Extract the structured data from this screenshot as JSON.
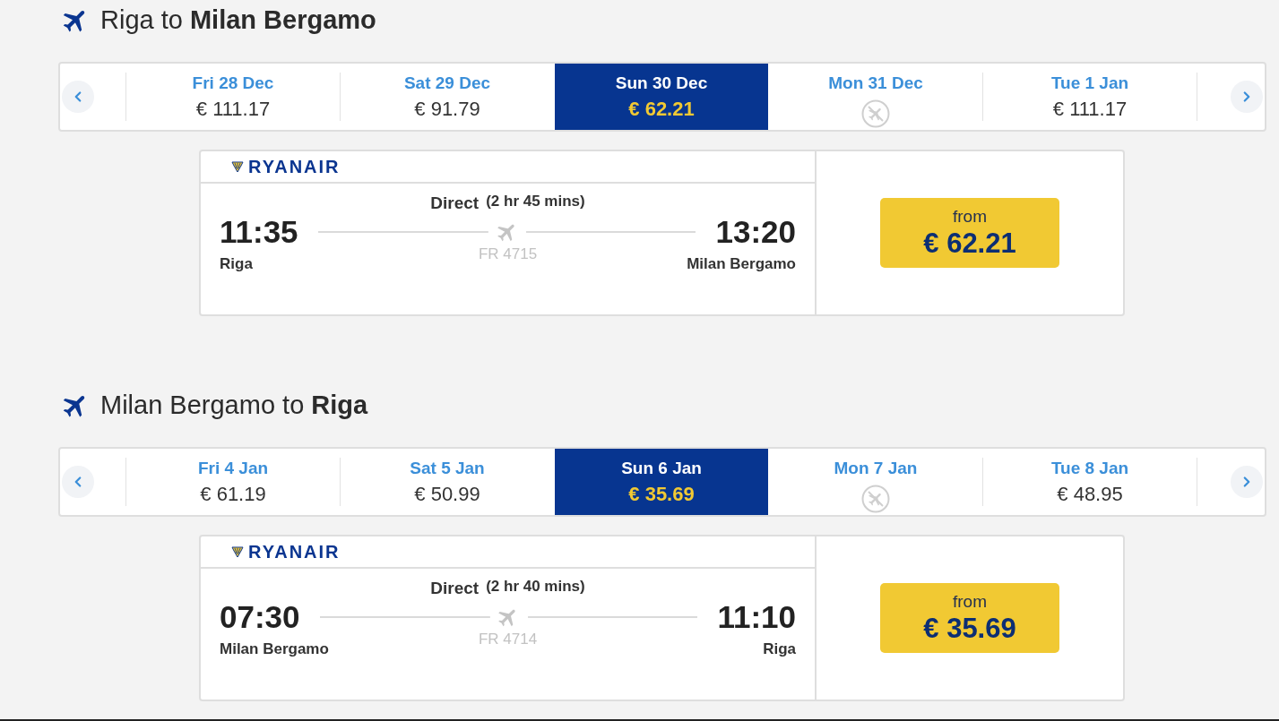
{
  "journeys": [
    {
      "title": "Riga to **Milan Bergamo**",
      "dates": [
        {
          "kind": "fare",
          "day": "Fri 28 Dec",
          "price": "€ 111.17",
          "selected": false
        },
        {
          "kind": "fare",
          "day": "Sat 29 Dec",
          "price": "€ 91.79",
          "selected": false
        },
        {
          "kind": "fare",
          "day": "Sun 30 Dec",
          "price": "€ 62.21",
          "selected": true
        },
        {
          "kind": "no_flights",
          "day": "Mon 31 Dec",
          "selected": false
        },
        {
          "kind": "fare",
          "day": "Tue 1 Jan",
          "price": "€ 111.17",
          "selected": false
        }
      ],
      "flight": {
        "airline": "RYANAIR",
        "stops": "Direct",
        "duration": "(2 hr 45 mins)",
        "departure": {
          "time": "11:35",
          "airport": "Riga"
        },
        "arrival": {
          "time": "13:20",
          "airport": "Milan Bergamo"
        },
        "flight_number": "FR 4715",
        "fare": {
          "label": "from",
          "price": "€ 62.21"
        }
      }
    },
    {
      "title": "Milan Bergamo to **Riga**",
      "dates": [
        {
          "kind": "fare",
          "day": "Fri 4 Jan",
          "price": "€ 61.19",
          "selected": false
        },
        {
          "kind": "fare",
          "day": "Sat 5 Jan",
          "price": "€ 50.99",
          "selected": false
        },
        {
          "kind": "fare",
          "day": "Sun 6 Jan",
          "price": "€ 35.69",
          "selected": true
        },
        {
          "kind": "no_flights",
          "day": "Mon 7 Jan",
          "selected": false
        },
        {
          "kind": "fare",
          "day": "Tue 8 Jan",
          "price": "€ 48.95",
          "selected": false
        }
      ],
      "flight": {
        "airline": "RYANAIR",
        "stops": "Direct",
        "duration": "(2 hr 40 mins)",
        "departure": {
          "time": "07:30",
          "airport": "Milan Bergamo"
        },
        "arrival": {
          "time": "11:10",
          "airport": "Riga"
        },
        "flight_number": "FR 4714",
        "fare": {
          "label": "from",
          "price": "€ 35.69"
        }
      }
    }
  ]
}
